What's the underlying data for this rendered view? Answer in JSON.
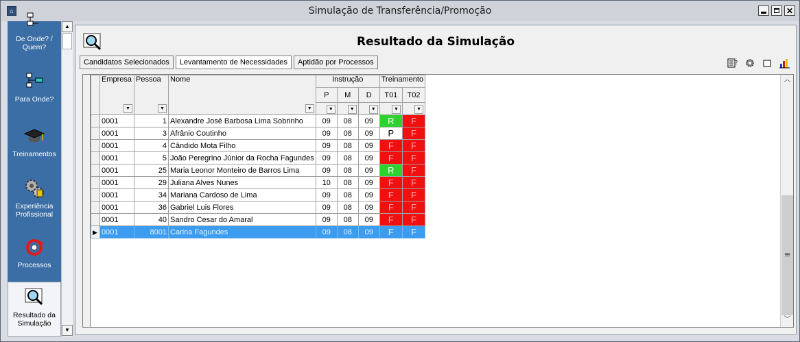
{
  "window": {
    "title": "Simulação de Transferência/Promoção",
    "app_icon": "app-icon"
  },
  "sidebar": {
    "items": [
      {
        "label_line1": "De Onde? /",
        "label_line2": "Quem?",
        "icon": "org-chart-from-icon"
      },
      {
        "label_line1": "Para Onde?",
        "label_line2": "",
        "icon": "org-chart-to-icon"
      },
      {
        "label_line1": "Treinamentos",
        "label_line2": "",
        "icon": "graduation-cap-icon"
      },
      {
        "label_line1": "Experiência",
        "label_line2": "Profissional",
        "icon": "gears-icon"
      },
      {
        "label_line1": "Processos",
        "label_line2": "",
        "icon": "process-cycle-icon"
      },
      {
        "label_line1": "Resultado da",
        "label_line2": "Simulação",
        "icon": "magnifier-report-icon",
        "selected": true
      }
    ]
  },
  "main": {
    "heading": "Resultado da Simulação",
    "tabs": [
      "Candidatos Selecionados",
      "Levantamento de Necessidades",
      "Aptidão por Processos"
    ],
    "active_tab": "Levantamento de Necessidades",
    "toolbar_icons": [
      "report-icon",
      "settings-icon",
      "window-icon",
      "bar-chart-icon"
    ]
  },
  "grid": {
    "headers": {
      "empresa": "Empresa",
      "pessoa": "Pessoa",
      "nome": "Nome",
      "instrucao": "Instrução",
      "treinamento": "Treinamento",
      "p": "P",
      "m": "M",
      "d": "D",
      "t01": "T01",
      "t02": "T02"
    },
    "rows": [
      {
        "empresa": "0001",
        "pessoa": "1",
        "nome": "Alexandre José Barbosa Lima Sobrinho",
        "p": "09",
        "m": "08",
        "d": "09",
        "t01": "R",
        "t02": "F"
      },
      {
        "empresa": "0001",
        "pessoa": "3",
        "nome": "Afrânio Coutinho",
        "p": "09",
        "m": "08",
        "d": "09",
        "t01": "P",
        "t02": "F"
      },
      {
        "empresa": "0001",
        "pessoa": "4",
        "nome": "Cândido Mota Filho",
        "p": "09",
        "m": "08",
        "d": "09",
        "t01": "F",
        "t02": "F"
      },
      {
        "empresa": "0001",
        "pessoa": "5",
        "nome": "João Peregrino Júnior da Rocha Fagundes",
        "p": "09",
        "m": "08",
        "d": "09",
        "t01": "F",
        "t02": "F"
      },
      {
        "empresa": "0001",
        "pessoa": "25",
        "nome": "Maria Leonor Monteiro de Barros Lima",
        "p": "09",
        "m": "08",
        "d": "09",
        "t01": "R",
        "t02": "F"
      },
      {
        "empresa": "0001",
        "pessoa": "29",
        "nome": "Juliana Alves Nunes",
        "p": "10",
        "m": "08",
        "d": "09",
        "t01": "F",
        "t02": "F"
      },
      {
        "empresa": "0001",
        "pessoa": "34",
        "nome": "Mariana Cardoso de Lima",
        "p": "09",
        "m": "08",
        "d": "09",
        "t01": "F",
        "t02": "F"
      },
      {
        "empresa": "0001",
        "pessoa": "36",
        "nome": "Gabriel Luis Flores",
        "p": "09",
        "m": "08",
        "d": "09",
        "t01": "F",
        "t02": "F"
      },
      {
        "empresa": "0001",
        "pessoa": "40",
        "nome": "Sandro Cesar do Amaral",
        "p": "09",
        "m": "08",
        "d": "09",
        "t01": "F",
        "t02": "F"
      },
      {
        "empresa": "0001",
        "pessoa": "8001",
        "nome": "Carina Fagundes",
        "p": "09",
        "m": "08",
        "d": "09",
        "t01": "F",
        "t02": "F",
        "selected": true
      }
    ],
    "status_colors": {
      "R": "#2ed12e",
      "F": "#f01010",
      "P": "#ffffff",
      "selected_row": "#3b9cf0"
    }
  }
}
